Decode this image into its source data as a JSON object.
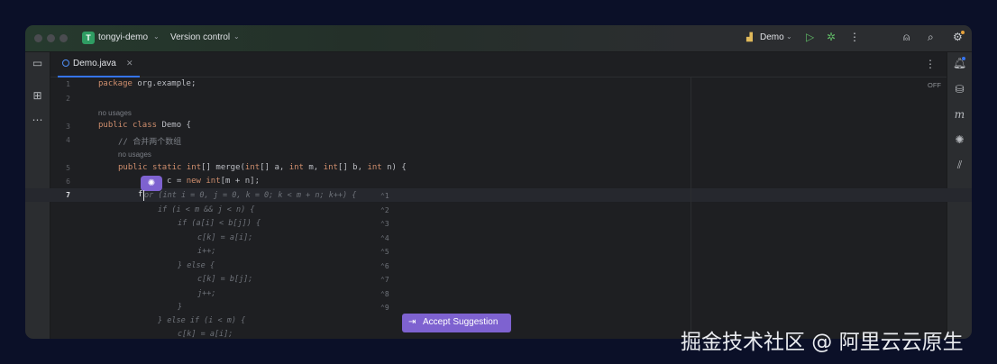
{
  "titlebar": {
    "project_badge": "T",
    "project_name": "tongyi-demo",
    "version_control": "Version control",
    "run_config": "Demo",
    "icons": [
      "run-icon",
      "debug-icon",
      "more-icon",
      "add-user-icon",
      "search-icon",
      "settings-icon"
    ]
  },
  "tabs": [
    {
      "label": "Demo.java",
      "active": true
    }
  ],
  "editor": {
    "reader_mode": "OFF",
    "line_numbers": [
      "1",
      "2",
      "3",
      "4",
      "5",
      "6",
      "7"
    ],
    "hints": {
      "usages_1": "no usages",
      "usages_2": "no usages"
    },
    "code": {
      "l1_kw": "package",
      "l1_rest": " org.example;",
      "l3_kw1": "public",
      "l3_kw2": "class",
      "l3_rest": " Demo {",
      "l4": "// 合并两个数组",
      "l5_a": "public",
      "l5_b": "static",
      "l5_c": "int",
      "l5_d": "[] merge(",
      "l5_e": "int",
      "l5_f": "[] a, ",
      "l5_g": "int",
      "l5_h": " m, ",
      "l5_i": "int",
      "l5_j": "[] b, ",
      "l5_k": "int",
      "l5_l": " n) {",
      "l6_a": "c = ",
      "l6_b": "new",
      "l6_c": " ",
      "l6_d": "int",
      "l6_e": "[m + n];",
      "l7_cursor_char": "f"
    },
    "ghost_lines": [
      "or (int i = 0, j = 0, k = 0; k < m + n; k++) {",
      "if (i < m && j < n) {",
      "if (a[i] < b[j]) {",
      "c[k] = a[i];",
      "i++;",
      "} else {",
      "c[k] = b[j];",
      "j++;",
      "}",
      "} else if (i < m) {",
      "c[k] = a[i];"
    ],
    "alt_hints": [
      "⌃1",
      "⌃2",
      "⌃3",
      "⌃4",
      "⌃5",
      "⌃6",
      "⌃7",
      "⌃8",
      "⌃9"
    ],
    "accept_key": "⇥",
    "accept_label": "Accept Suggestion"
  },
  "watermark": "掘金技术社区 @ 阿里云云原生"
}
